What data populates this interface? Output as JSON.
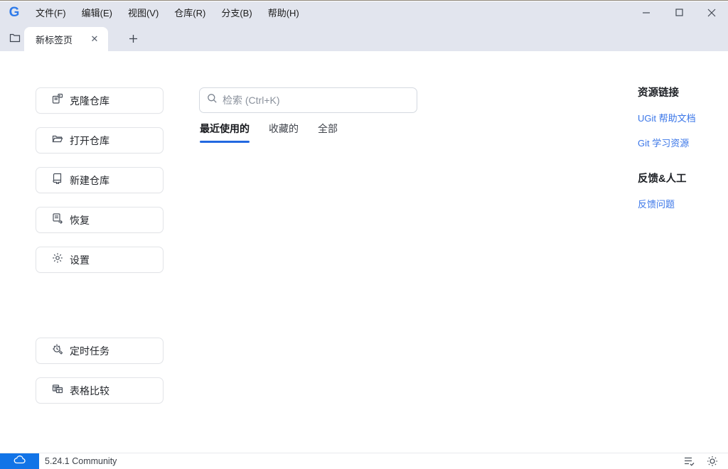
{
  "app": {
    "logo": "G",
    "version": "5.24.1 Community"
  },
  "menubar": {
    "items": [
      {
        "label": "文件(F)"
      },
      {
        "label": "编辑(E)"
      },
      {
        "label": "视图(V)"
      },
      {
        "label": "仓库(R)"
      },
      {
        "label": "分支(B)"
      },
      {
        "label": "帮助(H)"
      }
    ]
  },
  "tabbar": {
    "active_tab": {
      "label": "新标签页"
    },
    "close_glyph": "✕",
    "new_tab_glyph": "+"
  },
  "sidebar": {
    "buttons": [
      {
        "label": "克隆仓库",
        "icon": "repo-clone-icon"
      },
      {
        "label": "打开仓库",
        "icon": "folder-open-icon"
      },
      {
        "label": "新建仓库",
        "icon": "repo-new-icon"
      },
      {
        "label": "恢复",
        "icon": "repo-restore-icon"
      },
      {
        "label": "设置",
        "icon": "gear-icon"
      },
      {
        "label": "定时任务",
        "icon": "scheduled-task-icon"
      },
      {
        "label": "表格比较",
        "icon": "table-compare-icon"
      }
    ]
  },
  "main": {
    "search": {
      "placeholder": "检索 (Ctrl+K)"
    },
    "tabs": [
      {
        "label": "最近使用的",
        "active": true
      },
      {
        "label": "收藏的",
        "active": false
      },
      {
        "label": "全部",
        "active": false
      }
    ]
  },
  "right_panel": {
    "sections": [
      {
        "title": "资源链接",
        "links": [
          "UGit 帮助文档",
          "Git 学习资源"
        ]
      },
      {
        "title": "反馈&人工",
        "links": [
          "反馈问题"
        ]
      }
    ]
  },
  "statusbar": {
    "version": "5.24.1 Community"
  },
  "colors": {
    "titlebar_bg": "#e2e5ee",
    "accent_blue": "#2268e0",
    "link_blue": "#3a76e8",
    "badge_blue": "#1274e7"
  }
}
